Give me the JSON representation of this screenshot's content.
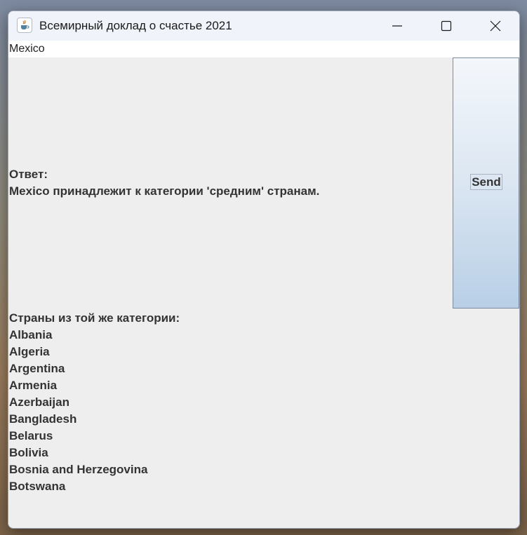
{
  "window": {
    "title": "Всемирный доклад о счастье 2021",
    "icon": "java-cup-icon",
    "controls": [
      "minimize-icon",
      "maximize-icon",
      "close-icon"
    ]
  },
  "input": {
    "value": "Mexico"
  },
  "answer": {
    "label": "Ответ:",
    "text": "Mexico принадлежит к категории 'средним' странам."
  },
  "send_button": {
    "label": "Send"
  },
  "same_category": {
    "heading": "Страны из той же категории:",
    "countries": [
      "Albania",
      "Algeria",
      "Argentina",
      "Armenia",
      "Azerbaijan",
      "Bangladesh",
      "Belarus",
      "Bolivia",
      "Bosnia and Herzegovina",
      "Botswana"
    ]
  }
}
